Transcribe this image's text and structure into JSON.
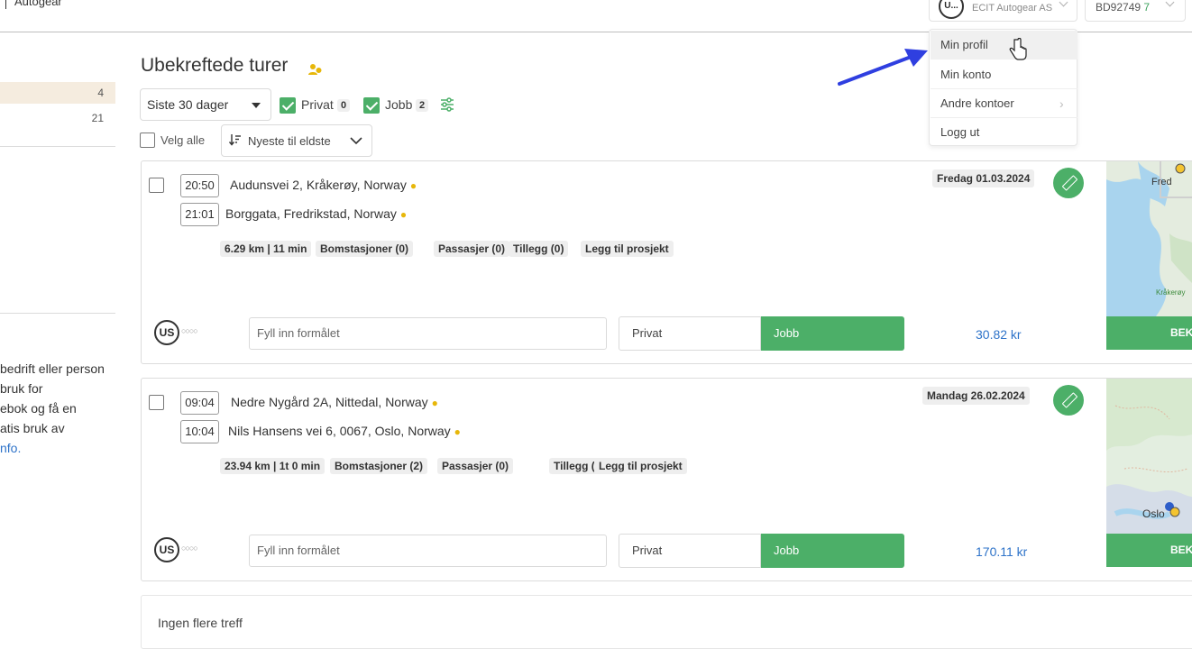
{
  "header": {
    "brand": "Autogear",
    "account": {
      "avatar": "U...",
      "company": "ECIT Autogear AS"
    },
    "user": {
      "id": "BD92749",
      "suffix": "7"
    }
  },
  "account_menu": {
    "items": [
      {
        "label": "Min profil"
      },
      {
        "label": "Min konto"
      },
      {
        "label": "Andre kontoer"
      },
      {
        "label": "Logg ut"
      }
    ]
  },
  "sidebar": {
    "items": [
      {
        "label": "",
        "count": "4"
      },
      {
        "label": "",
        "count": "21"
      }
    ],
    "promo": {
      "line1": "bedrift eller person",
      "line2": "bruk for",
      "line3": "ebok og få en",
      "line4": "atis bruk av",
      "link": "nfo."
    }
  },
  "page": {
    "title": "Ubekreftede turer",
    "period": "Siste 30 dager",
    "filters": [
      {
        "label": "Privat",
        "count": "0"
      },
      {
        "label": "Jobb",
        "count": "2"
      }
    ],
    "select_all": "Velg alle",
    "sort": "Nyeste til eldste",
    "no_more": "Ingen flere treff"
  },
  "trips": [
    {
      "date": "Fredag 01.03.2024",
      "start_time": "20:50",
      "start_address": "Audunsvei 2, Kråkerøy, Norway",
      "end_time": "21:01",
      "end_address": "Borggata, Fredrikstad, Norway",
      "chips": [
        "6.29 km | 11 min",
        "Bomstasjoner (0)",
        "Passasjer (0)",
        "Tillegg (0)",
        "Legg til prosjekt"
      ],
      "logo": "US",
      "purpose_placeholder": "Fyll inn formålet",
      "privat_label": "Privat",
      "jobb_label": "Jobb",
      "amount": "30.82 kr",
      "confirm_label": "BEK",
      "map_labels": [
        "Fred",
        "Kråkerøy"
      ]
    },
    {
      "date": "Mandag 26.02.2024",
      "start_time": "09:04",
      "start_address": "Nedre Nygård 2A, Nittedal, Norway",
      "end_time": "10:04",
      "end_address": "Nils Hansens vei 6, 0067, Oslo, Norway",
      "chips": [
        "23.94 km | 1t 0 min",
        "Bomstasjoner (2)",
        "Passasjer (0)",
        "Tillegg (0)",
        "Legg til prosjekt"
      ],
      "logo": "US",
      "purpose_placeholder": "Fyll inn formålet",
      "privat_label": "Privat",
      "jobb_label": "Jobb",
      "amount": "170.11 kr",
      "confirm_label": "BEK",
      "map_labels": [
        "Oslo"
      ]
    }
  ],
  "colors": {
    "accent_green": "#4caf68",
    "link_blue": "#2e73c9",
    "tag_yellow": "#e7b70a",
    "arrow_blue": "#2f3fe0"
  }
}
